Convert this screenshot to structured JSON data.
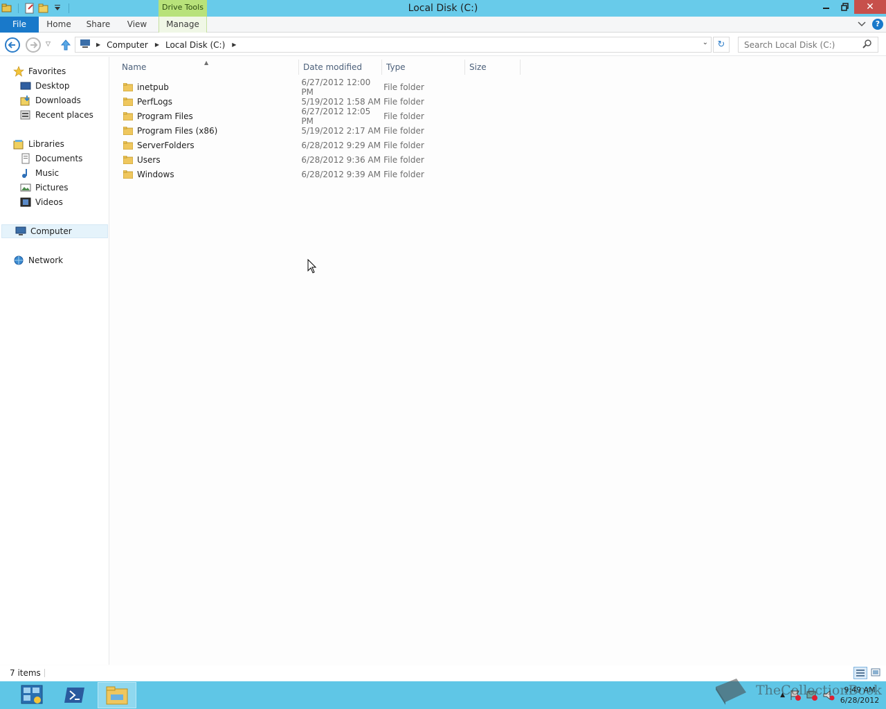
{
  "window": {
    "title": "Local Disk (C:)",
    "context_tab_group": "Drive Tools"
  },
  "ribbon": {
    "tabs": [
      "File",
      "Home",
      "Share",
      "View",
      "Manage"
    ]
  },
  "address_bar": {
    "crumbs": [
      "Computer",
      "Local Disk (C:)"
    ],
    "search_placeholder": "Search Local Disk (C:)"
  },
  "navigation_pane": {
    "favorites": {
      "label": "Favorites",
      "items": [
        "Desktop",
        "Downloads",
        "Recent places"
      ]
    },
    "libraries": {
      "label": "Libraries",
      "items": [
        "Documents",
        "Music",
        "Pictures",
        "Videos"
      ]
    },
    "computer": "Computer",
    "network": "Network"
  },
  "file_list": {
    "columns": [
      "Name",
      "Date modified",
      "Type",
      "Size"
    ],
    "rows": [
      {
        "name": "inetpub",
        "date": "6/27/2012 12:00 PM",
        "type": "File folder",
        "size": ""
      },
      {
        "name": "PerfLogs",
        "date": "5/19/2012 1:58 AM",
        "type": "File folder",
        "size": ""
      },
      {
        "name": "Program Files",
        "date": "6/27/2012 12:05 PM",
        "type": "File folder",
        "size": ""
      },
      {
        "name": "Program Files (x86)",
        "date": "5/19/2012 2:17 AM",
        "type": "File folder",
        "size": ""
      },
      {
        "name": "ServerFolders",
        "date": "6/28/2012 9:29 AM",
        "type": "File folder",
        "size": ""
      },
      {
        "name": "Users",
        "date": "6/28/2012 9:36 AM",
        "type": "File folder",
        "size": ""
      },
      {
        "name": "Windows",
        "date": "6/28/2012 9:39 AM",
        "type": "File folder",
        "size": ""
      }
    ]
  },
  "status_bar": {
    "item_count": "7 items"
  },
  "taskbar": {
    "clock_time": "9:49 AM",
    "clock_date": "6/28/2012",
    "watermark": "TheCollectionBook"
  },
  "colors": {
    "titlebar": "#68cbea",
    "file_tab": "#1979ca",
    "context_tab": "#b8e27a",
    "taskbar": "#5fc6e6",
    "close_button": "#c7504b"
  }
}
